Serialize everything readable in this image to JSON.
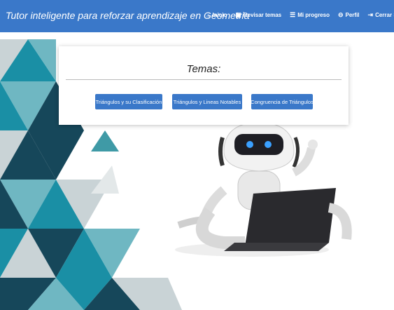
{
  "navbar": {
    "brand": "Tutor inteligente para reforzar aprendizaje en Geometria",
    "links": [
      {
        "label": "Inicio",
        "icon": "⌂",
        "icon_name": "home-icon"
      },
      {
        "label": "Revisar temas",
        "icon": "▣",
        "icon_name": "book-icon"
      },
      {
        "label": "Mi progreso",
        "icon": "☰",
        "icon_name": "list-icon"
      },
      {
        "label": "Perfil",
        "icon": "⊖",
        "icon_name": "user-icon"
      },
      {
        "label": "Cerrar Sesión",
        "icon": "⇥",
        "icon_name": "logout-icon"
      }
    ]
  },
  "panel": {
    "title": "Temas:",
    "buttons": [
      "Triángulos y su Clasificación",
      "Triángulos y Lineas Notables",
      "Congruencia de Triángulos"
    ]
  },
  "colors": {
    "navbar": "#3a78c9",
    "button": "#3a78c9",
    "teal": "#1a8fa5",
    "dark_teal": "#16475a",
    "light_teal": "#6fb7c2",
    "grey": "#c9d3d6"
  }
}
